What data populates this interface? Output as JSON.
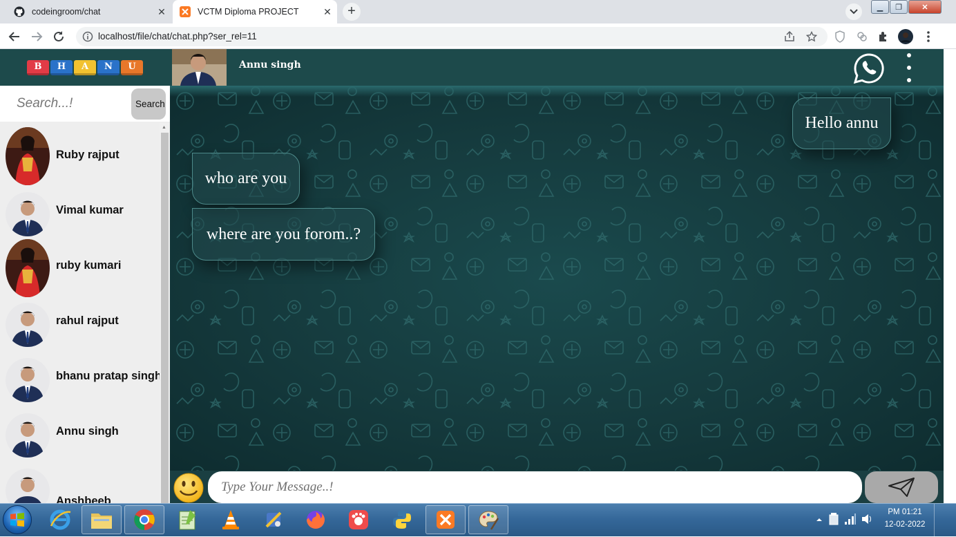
{
  "browser": {
    "tabs": [
      {
        "title": "codeingroom/chat",
        "active": false
      },
      {
        "title": "VCTM Diploma PROJECT",
        "active": true
      }
    ],
    "url": "localhost/file/chat/chat.php?ser_rel=11"
  },
  "sidebar": {
    "logo_letters": [
      "B",
      "H",
      "A",
      "N",
      "U"
    ],
    "logo_colors": [
      "#e23b46",
      "#2a72c9",
      "#f2c230",
      "#2a72c9",
      "#e8772a"
    ],
    "search": {
      "placeholder": "Search...!",
      "button_label": "Search"
    },
    "contacts": [
      {
        "name": "Ruby rajput",
        "avatar": "woman-red"
      },
      {
        "name": "Vimal kumar",
        "avatar": "man-suit"
      },
      {
        "name": "ruby kumari",
        "avatar": "woman-red"
      },
      {
        "name": "rahul rajput",
        "avatar": "man-suit"
      },
      {
        "name": "bhanu pratap singh",
        "avatar": "man-suit"
      },
      {
        "name": "Annu singh",
        "avatar": "man-suit"
      },
      {
        "name": "Anshbeeb",
        "avatar": "man-suit"
      }
    ]
  },
  "chat": {
    "contact_name": "Annu singh",
    "messages": [
      {
        "text": "Hello annu",
        "direction": "sent"
      },
      {
        "text": "who are you",
        "direction": "received"
      },
      {
        "text": "where are you forom..?",
        "direction": "received"
      }
    ],
    "composer": {
      "placeholder": "Type Your Message..!"
    }
  },
  "taskbar": {
    "time": "PM 01:21",
    "date": "12-02-2022"
  },
  "colors": {
    "header": "#1d4a4b",
    "chat_background": "#153a3d",
    "bubble_border": "#4d8a8a",
    "send_button": "#a9a9a9"
  }
}
